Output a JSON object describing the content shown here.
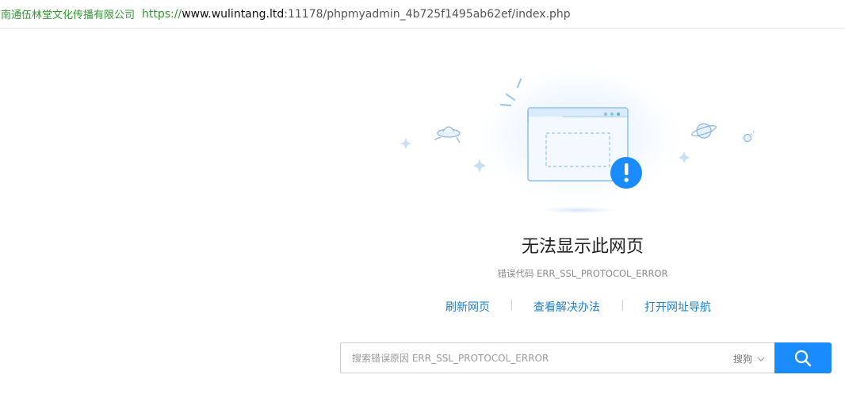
{
  "address_bar": {
    "cert_org": "南通伍林堂文化传播有限公司",
    "url_scheme": "https://",
    "url_host": "www.wulintang.ltd",
    "url_path": ":11178/phpmyadmin_4b725f1495ab62ef/index.php"
  },
  "error": {
    "title": "无法显示此网页",
    "code_label": "错误代码 ERR_SSL_PROTOCOL_ERROR"
  },
  "actions": {
    "refresh": "刷新网页",
    "solution": "查看解决办法",
    "nav": "打开网址导航",
    "separator": "|"
  },
  "search": {
    "placeholder": "搜索错误原因 ERR_SSL_PROTOCOL_ERROR",
    "engine": "搜狗"
  },
  "colors": {
    "accent": "#1a8cff",
    "link": "#1a7fd0",
    "cert_green": "#2e9b2e"
  },
  "icons": {
    "illustration": "browser-window-error-icon",
    "search_button": "search-icon",
    "engine_dropdown": "chevron-down-icon"
  }
}
